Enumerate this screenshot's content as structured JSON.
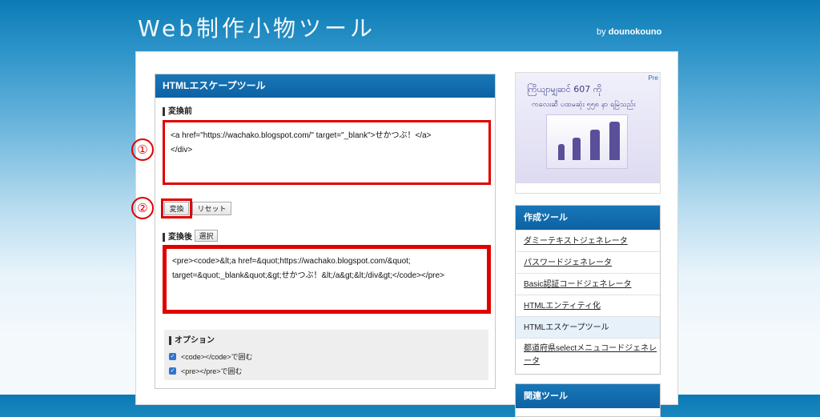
{
  "site": {
    "title": "Web制作小物ツール",
    "by_prefix": "by ",
    "by_author": "dounokouno"
  },
  "tool": {
    "title": "HTMLエスケープツール",
    "before_label": "変換前",
    "before_line1": "<a href=\"https://wachako.blogspot.com/\" target=\"_blank\">せかつぶ！</a>",
    "before_line2": "</div>",
    "convert_button": "変換",
    "reset_button": "リセット",
    "after_label": "変換後",
    "select_button": "選択",
    "after_line1": "<pre><code>&lt;a href=&quot;https://wachako.blogspot.com/&quot;",
    "after_line2": "target=&quot;_blank&quot;&gt;せかつぶ！&lt;/a&gt;&lt;/div&gt;</code></pre>",
    "marker1": "①",
    "marker2": "②"
  },
  "options": {
    "title": "オプション",
    "items": [
      {
        "label": "<code></code>で囲む",
        "checked": true
      },
      {
        "label": "<pre></pre>で囲む",
        "checked": true
      }
    ]
  },
  "ad": {
    "line1": "ကြိယျာမျှဆင် 607 ကို",
    "line2": "ကလေးဆီ ပထမဆုံး ၅၅၈ နာ ရမြဲသည်း",
    "badge": "Pre"
  },
  "sidebar": {
    "heading": "作成ツール",
    "items": [
      "ダミーテキストジェネレータ",
      "パスワードジェネレータ",
      "Basic認証コードジェネレータ",
      "HTMLエンティティ化",
      "HTMLエスケープツール",
      "都道府県selectメニュコードジェネレータ"
    ],
    "heading2": "関連ツール"
  },
  "colors": {
    "accent": "#0d62a3",
    "highlight": "#e00000"
  }
}
